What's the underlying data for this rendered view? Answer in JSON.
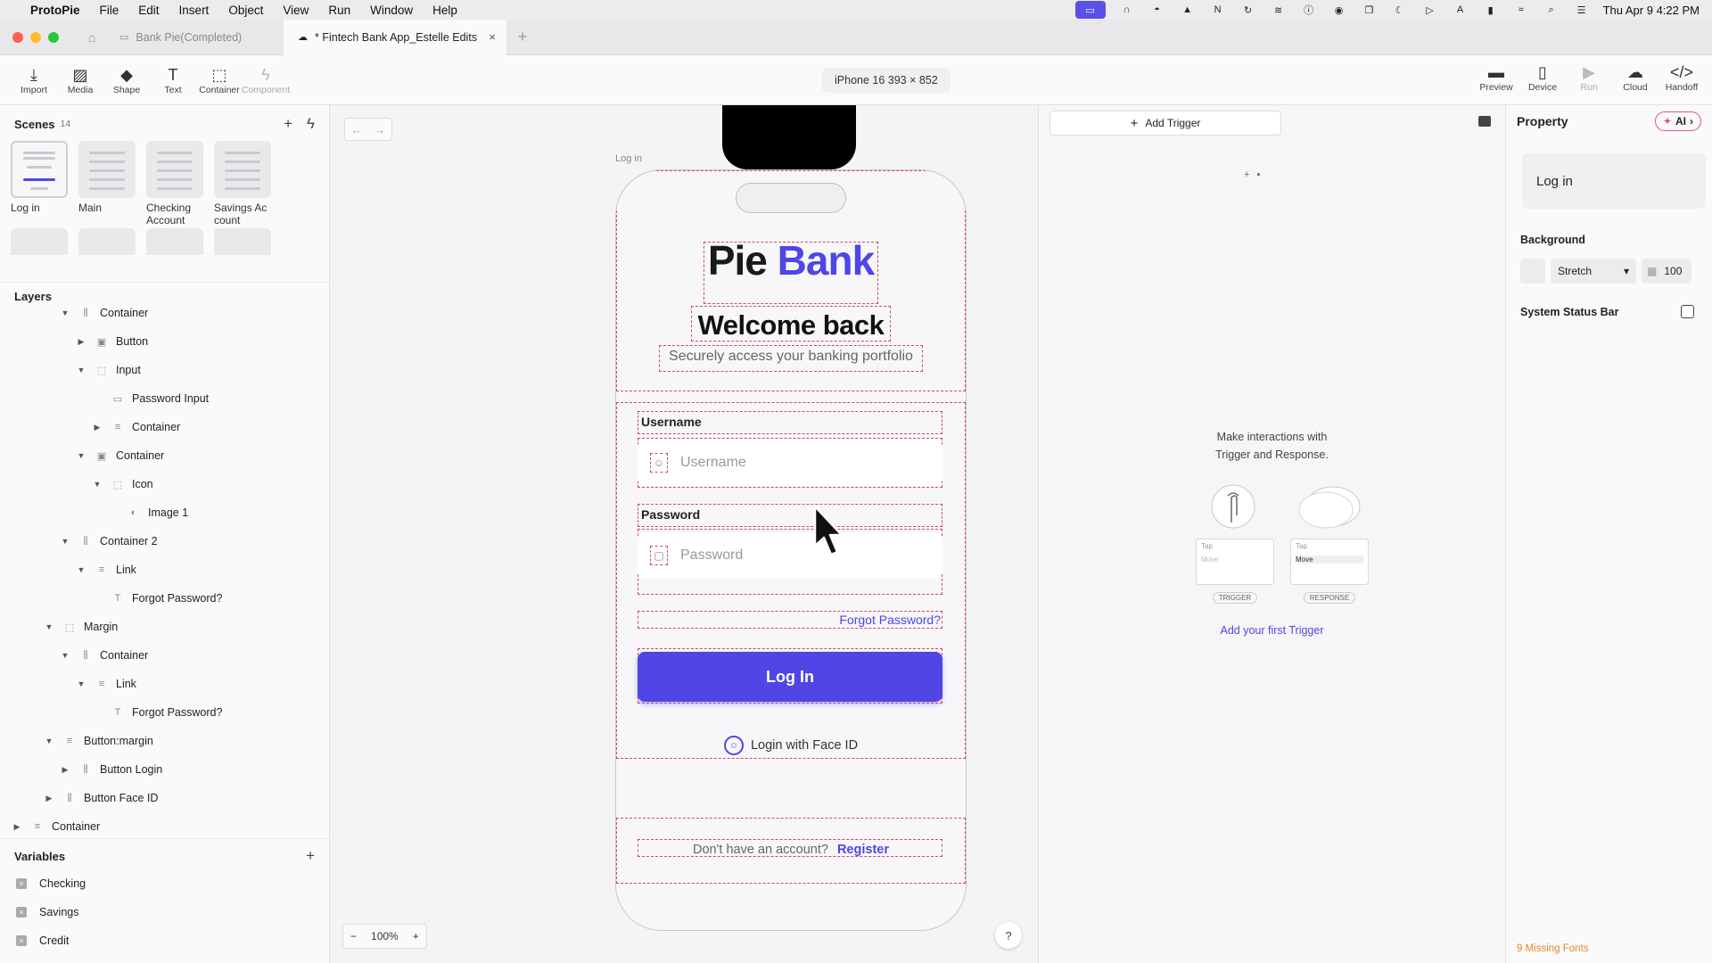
{
  "menubar": {
    "app_name": "ProtoPie",
    "items": [
      "File",
      "Edit",
      "Insert",
      "Object",
      "View",
      "Run",
      "Window",
      "Help"
    ],
    "datetime": "Thu Apr 9  4:22 PM"
  },
  "tabs": [
    {
      "label": "Bank Pie(Completed)",
      "active": false
    },
    {
      "label": "* Fintech Bank App_Estelle Edits",
      "active": true
    }
  ],
  "toolbar": {
    "left_tools": [
      {
        "label": "Import",
        "icon": "import-icon"
      },
      {
        "label": "Media",
        "icon": "media-icon"
      },
      {
        "label": "Shape",
        "icon": "shape-icon"
      },
      {
        "label": "Text",
        "icon": "text-icon"
      },
      {
        "label": "Container",
        "icon": "container-icon"
      },
      {
        "label": "Component",
        "icon": "component-icon"
      }
    ],
    "device": "iPhone 16  393 × 852",
    "right_tools": [
      {
        "label": "Preview",
        "icon": "preview-icon"
      },
      {
        "label": "Device",
        "icon": "device-icon"
      },
      {
        "label": "Run",
        "icon": "run-icon"
      },
      {
        "label": "Cloud",
        "icon": "cloud-icon"
      },
      {
        "label": "Handoff",
        "icon": "handoff-icon"
      }
    ]
  },
  "scenes": {
    "title": "Scenes",
    "count": "14",
    "items": [
      "Log in",
      "Main",
      "Checking Account",
      "Savings Ac count"
    ]
  },
  "layers": {
    "title": "Layers",
    "items": [
      {
        "label": "Container",
        "depth": 3,
        "caret": "open",
        "icon": "horizontal-stack-icon"
      },
      {
        "label": "Button",
        "depth": 4,
        "caret": "closed",
        "icon": "button-layer-icon"
      },
      {
        "label": "Input",
        "depth": 4,
        "caret": "open",
        "icon": "frame-icon"
      },
      {
        "label": "Password Input",
        "depth": 5,
        "caret": "none",
        "icon": "input-layer-icon"
      },
      {
        "label": "Container",
        "depth": 5,
        "caret": "closed",
        "icon": "vertical-stack-icon"
      },
      {
        "label": "Container",
        "depth": 4,
        "caret": "open",
        "icon": "button-layer-icon"
      },
      {
        "label": "Icon",
        "depth": 5,
        "caret": "open",
        "icon": "frame-icon"
      },
      {
        "label": "Image 1",
        "depth": 6,
        "caret": "none",
        "icon": "image-layer-icon"
      },
      {
        "label": "Container 2",
        "depth": 3,
        "caret": "open",
        "icon": "horizontal-stack-icon"
      },
      {
        "label": "Link",
        "depth": 4,
        "caret": "open",
        "icon": "vertical-stack-icon"
      },
      {
        "label": "Forgot Password?",
        "depth": 5,
        "caret": "none",
        "icon": "text-layer-icon"
      },
      {
        "label": "Margin",
        "depth": 2,
        "caret": "open",
        "icon": "frame-icon"
      },
      {
        "label": "Container",
        "depth": 3,
        "caret": "open",
        "icon": "horizontal-stack-icon"
      },
      {
        "label": "Link",
        "depth": 4,
        "caret": "open",
        "icon": "vertical-stack-icon"
      },
      {
        "label": "Forgot Password?",
        "depth": 5,
        "caret": "none",
        "icon": "text-box-icon"
      },
      {
        "label": "Button:margin",
        "depth": 2,
        "caret": "open",
        "icon": "vertical-stack-icon"
      },
      {
        "label": "Button Login",
        "depth": 3,
        "caret": "closed",
        "icon": "horizontal-stack-icon"
      },
      {
        "label": "Button Face ID",
        "depth": 2,
        "caret": "closed",
        "icon": "horizontal-stack-icon"
      },
      {
        "label": "Container",
        "depth": 0,
        "caret": "closed",
        "icon": "vertical-stack-icon"
      }
    ]
  },
  "variables": {
    "title": "Variables",
    "items": [
      "Checking",
      "Savings",
      "Credit"
    ]
  },
  "canvas": {
    "frame_label": "Log in",
    "zoom": "100%",
    "help": "?"
  },
  "phone": {
    "brand_main": "Pie",
    "brand_accent": "Bank",
    "welcome": "Welcome back",
    "subtitle": "Securely access your banking portfolio",
    "username_label": "Username",
    "username_placeholder": "Username",
    "password_label": "Password",
    "password_placeholder": "Password",
    "forgot": "Forgot Password?",
    "login_button": "Log In",
    "faceid": "Login with Face ID",
    "register_prompt": "Don't have an account?",
    "register_link": "Register",
    "accent_color": "#4f46e5"
  },
  "interactions": {
    "add_trigger": "Add Trigger",
    "empty_line1": "Make interactions with",
    "empty_line2": "Trigger and Response.",
    "card_tap": "Tap",
    "card_move": "Move",
    "trigger_caption": "TRIGGER",
    "response_caption": "RESPONSE",
    "first_trigger": "Add your first Trigger"
  },
  "properties": {
    "title": "Property",
    "ai_label": "AI",
    "name": "Log in",
    "background_label": "Background",
    "fill_mode": "Stretch",
    "opacity": "100",
    "status_bar_label": "System Status Bar",
    "missing_fonts": "9 Missing Fonts"
  }
}
